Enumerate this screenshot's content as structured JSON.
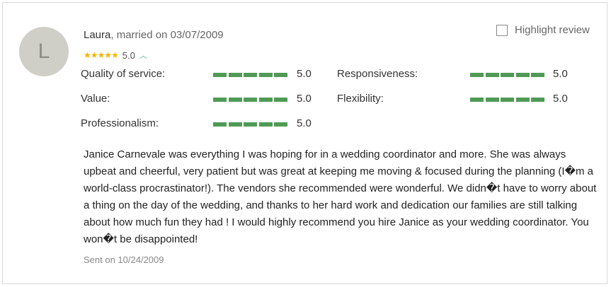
{
  "reviewer": {
    "initial": "L",
    "name": "Laura",
    "meta": ", married on 03/07/2009"
  },
  "overall": {
    "stars": "★★★★★",
    "score": "5.0",
    "chevron_glyph": "︿"
  },
  "highlight": {
    "label": "Highlight review",
    "checked": false
  },
  "metrics": [
    {
      "label": "Quality of service:",
      "score": "5.0",
      "filled_segments": 5
    },
    {
      "label": "Responsiveness:",
      "score": "5.0",
      "filled_segments": 5
    },
    {
      "label": "Value:",
      "score": "5.0",
      "filled_segments": 5
    },
    {
      "label": "Flexibility:",
      "score": "5.0",
      "filled_segments": 5
    },
    {
      "label": "Professionalism:",
      "score": "5.0",
      "filled_segments": 5
    }
  ],
  "review_text": "Janice Carnevale was everything I was hoping for in a wedding coordinator and more. She was always upbeat and cheerful, very patient but was great at keeping me moving & focused during the planning (I�m a world-class procrastinator!). The vendors she recommended were wonderful. We didn�t have to worry about a thing on the day of the wedding, and thanks to her hard work and dedication our families are still talking about how much fun they had ! I would highly recommend you hire Janice as your wedding coordinator. You won�t be disappointed!",
  "sent": "Sent on 10/24/2009",
  "colors": {
    "bar": "#4f9a55",
    "star": "#f5b301",
    "chevron": "#4aa98e",
    "avatar_bg": "#cfcfc7"
  }
}
